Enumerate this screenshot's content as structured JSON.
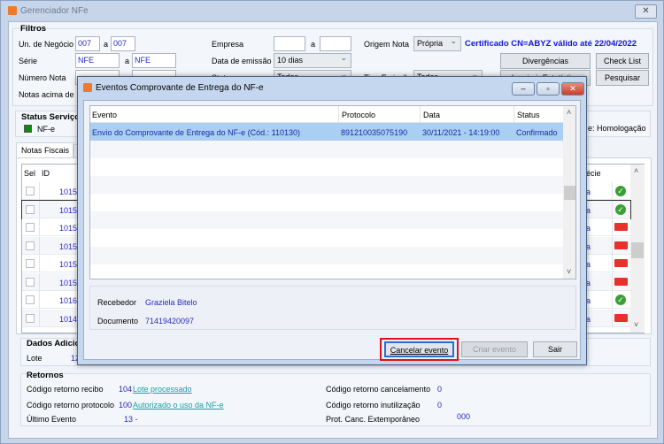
{
  "window": {
    "title": "Gerenciador NFe",
    "close_icon": "close-icon"
  },
  "filtros": {
    "title": "Filtros",
    "un_negocio_label": "Un. de Negócio",
    "un_from": "007",
    "un_to": "007",
    "a": "a",
    "serie_label": "Série",
    "serie_from": "NFE",
    "serie_to": "NFE",
    "numero_label": "Número Nota",
    "notas_acima_label": "Notas acima de",
    "empresa_label": "Empresa",
    "data_emissao_label": "Data de emissão",
    "data_emissao_value": "10 dias",
    "status_label": "Status",
    "status_value": "Todos",
    "origem_label": "Origem Nota",
    "origem_value": "Própria",
    "tipo_emissao_label": "Tipo Emissão",
    "tipo_emissao_value": "Todos",
    "certificado": "Certificado CN=ABYZ válido até 22/04/2022",
    "btn_divergencias": "Divergências",
    "btn_checklist": "Check List",
    "btn_imprimir": "Imprimir Estatística",
    "btn_pesquisar": "Pesquisar"
  },
  "status_servico": {
    "title": "Status Serviço",
    "nfe_label": "NF-e",
    "ambiente": "e: Homologação",
    "status_color": "#0a8a0a"
  },
  "tabs": [
    {
      "label": "Notas Fiscais"
    },
    {
      "label": "C"
    }
  ],
  "notas": {
    "col_sel": "Sel",
    "col_id": "ID",
    "col_especie": "pécie",
    "rows": [
      {
        "id": "1015",
        "esp": "da",
        "icon": "check"
      },
      {
        "id": "1015",
        "esp": "da",
        "icon": "check"
      },
      {
        "id": "1015",
        "esp": "da",
        "icon": "truck"
      },
      {
        "id": "1015",
        "esp": "da",
        "icon": "truck"
      },
      {
        "id": "1015",
        "esp": "da",
        "icon": "truck"
      },
      {
        "id": "1015",
        "esp": "da",
        "icon": "truck"
      },
      {
        "id": "1016",
        "esp": "da",
        "icon": "check"
      },
      {
        "id": "1014",
        "esp": "da",
        "icon": "truck"
      }
    ]
  },
  "dados": {
    "title": "Dados Adicio",
    "lote_label": "Lote",
    "lote_value": "12"
  },
  "retornos": {
    "title": "Retornos",
    "recibo_label": "Código retorno recibo",
    "recibo_code": "104",
    "recibo_link": "Lote processado",
    "protocolo_label": "Código retorno protocolo",
    "protocolo_code": "100",
    "protocolo_link": "Autorizado o uso da NF-e",
    "ultimo_label": "Último Evento",
    "ultimo_value": "13 -",
    "canc_label": "Código retorno cancelamento",
    "canc_value": "0",
    "inut_label": "Código retorno inutilização",
    "inut_value": "0",
    "prot_label": "Prot. Canc. Extemporâneo",
    "prot_value": "000"
  },
  "dialog": {
    "title": "Eventos Comprovante de Entrega do NF-e",
    "columns": [
      "Evento",
      "Protocolo",
      "Data",
      "Status"
    ],
    "rows": [
      {
        "evento": "Envio do Comprovante de Entrega do NF-e (Cód.: 110130)",
        "protocolo": "891210035075190",
        "data": "30/11/2021 - 14:19:00",
        "status": "Confirmado"
      }
    ],
    "recebedor_label": "Recebedor",
    "recebedor_value": "Graziela Bitelo",
    "documento_label": "Documento",
    "documento_value": "71419420097",
    "btn_cancelar": "Cancelar evento",
    "btn_criar": "Criar evento",
    "btn_sair": "Sair"
  }
}
